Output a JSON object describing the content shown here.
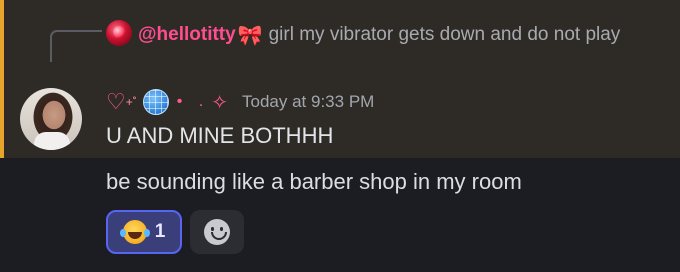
{
  "reply": {
    "username": "@hellotitty",
    "bow_glyph": "🎀",
    "text": "girl my vibrator gets down and do not play"
  },
  "message": {
    "name_decoration": {
      "heart": "♡",
      "small_sparkle": "˚",
      "small_plus": "+",
      "dots": "• .",
      "sparkle": "✧"
    },
    "timestamp": "Today at 9:33 PM",
    "lines": [
      "U AND MINE BOTHHH",
      "be sounding like a barber shop in my room"
    ]
  },
  "reactions": [
    {
      "emoji": "joy-emoji",
      "count": "1",
      "selected": true
    }
  ],
  "colors": {
    "mention_bar": "#e7a52b",
    "mention_bg": "#2e2b27",
    "username": "#ff4d8f",
    "reaction_border": "#5865f2"
  },
  "icons": [
    "reply-avatar",
    "user-avatar",
    "globe-emoji",
    "heart-icon",
    "sparkle-icon",
    "joy-emoji",
    "add-reaction-icon"
  ]
}
